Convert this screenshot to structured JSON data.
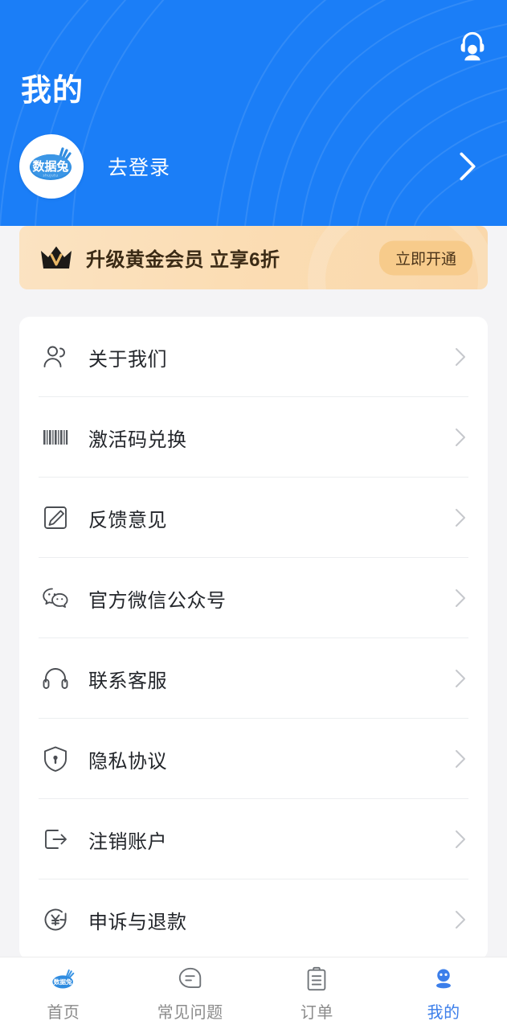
{
  "header": {
    "title": "我的",
    "service_icon": "headset-customer-service-icon",
    "brand_logo_text": "数据兔",
    "login_label": "去登录",
    "chevron_icon": "chevron-right-icon",
    "bg_color": "#1b7ef7"
  },
  "vip_banner": {
    "crown_icon": "crown-vip-icon",
    "text": "升级黄金会员  立享6折",
    "button_label": "立即开通",
    "bg_color": "#fbdfb8",
    "button_color": "#f7cb8b"
  },
  "menu": {
    "items": [
      {
        "label": "关于我们",
        "icon": "user-group-icon"
      },
      {
        "label": "激活码兑换",
        "icon": "barcode-icon"
      },
      {
        "label": "反馈意见",
        "icon": "edit-pencil-icon"
      },
      {
        "label": "官方微信公众号",
        "icon": "wechat-icon"
      },
      {
        "label": "联系客服",
        "icon": "headphones-icon"
      },
      {
        "label": "隐私协议",
        "icon": "shield-lock-icon"
      },
      {
        "label": "注销账户",
        "icon": "logout-icon"
      },
      {
        "label": "申诉与退款",
        "icon": "yen-refund-icon"
      }
    ],
    "chevron_icon": "chevron-right-icon"
  },
  "bottom_nav": {
    "active_color": "#3b7eea",
    "inactive_color": "#8b8b8b",
    "items": [
      {
        "label": "首页",
        "icon": "brand-rabbit-logo-icon",
        "active": false
      },
      {
        "label": "常见问题",
        "icon": "speech-bubble-icon",
        "active": false
      },
      {
        "label": "订单",
        "icon": "clipboard-icon",
        "active": false
      },
      {
        "label": "我的",
        "icon": "person-icon",
        "active": true
      }
    ]
  }
}
